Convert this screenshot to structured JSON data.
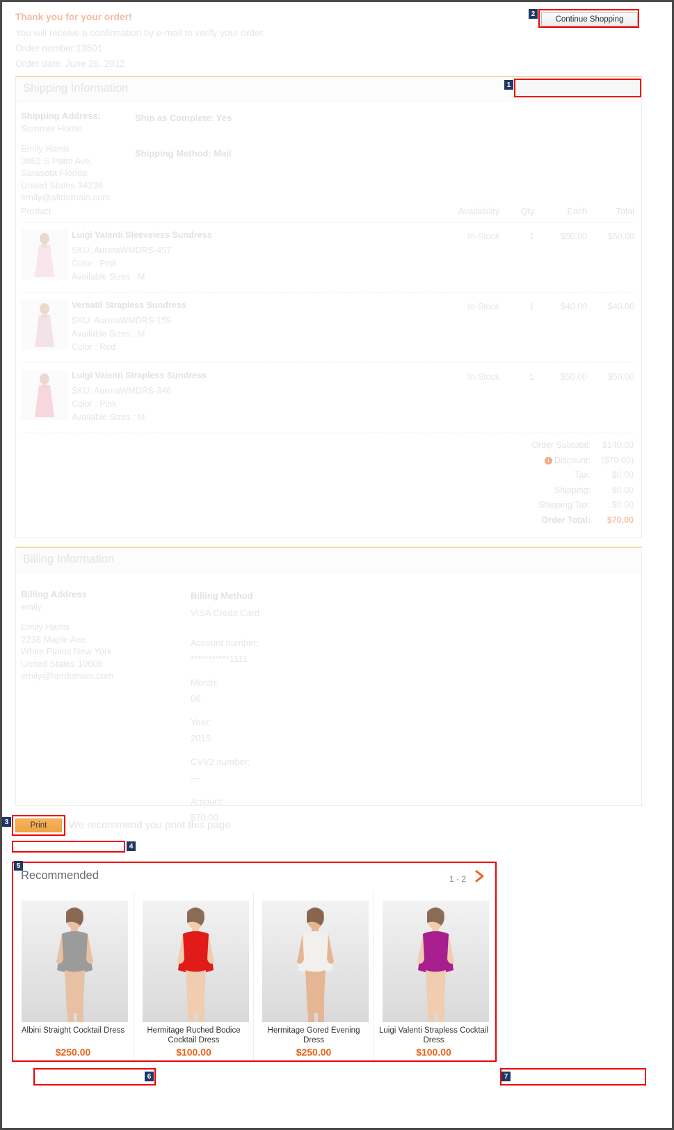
{
  "header": {
    "thank_you": "Thank you for your order!",
    "confirmation": "You will receive a confirmation by e-mail to verify your order.",
    "order_number": "Order number:13501",
    "order_date": "Order date: June 26, 2012",
    "continue_shopping": "Continue Shopping"
  },
  "shipping": {
    "section_title": "Shipping Information",
    "address_label": "Shipping Address:",
    "address_nickname": "Summer Home",
    "name": "Emily Harris",
    "street": "3862 S Palm Ave.",
    "city_state": "Sarasota Florida",
    "country_zip": "United States 34236",
    "email": "emily@altdomain.com",
    "ship_as_complete": "Ship as Complete: Yes",
    "shipping_method": "Shipping Method: Mail"
  },
  "product_table": {
    "columns": {
      "product": "Product",
      "availability": "Availability",
      "qty": "Qty",
      "each": "Each",
      "total": "Total"
    },
    "rows": [
      {
        "name": "Luigi Valenti Sleeveless Sundress",
        "sku": "SKU: AuroraWMDRS-457",
        "attr1": "Color : Pink",
        "attr2": "Available Sizes : M",
        "availability": "In-Stock",
        "qty": "1",
        "each": "$50.00",
        "total": "$50.00",
        "thumb_color": "#f7c9d4"
      },
      {
        "name": "Versatil Strapless Sundress",
        "sku": "SKU: AuroraWMDRS-159",
        "attr1": "Available Sizes : M",
        "attr2": "Color : Red",
        "availability": "In-Stock",
        "qty": "1",
        "each": "$40.00",
        "total": "$40.00",
        "thumb_color": "#e8c3cf"
      },
      {
        "name": "Luigi Valenti Strapless Sundress",
        "sku": "SKU: AuroraWMDRS-346",
        "attr1": "Color : Pink",
        "attr2": "Available Sizes : M",
        "availability": "In-Stock",
        "qty": "1",
        "each": "$50.00",
        "total": "$50.00",
        "thumb_color": "#f3a9b8"
      }
    ]
  },
  "totals": [
    {
      "label": "Order Subtotal:",
      "value": "$140.00",
      "icon": ""
    },
    {
      "label": "Discount:",
      "value": "($70.00)",
      "icon": "info-icon"
    },
    {
      "label": "Tax:",
      "value": "$0.00",
      "icon": ""
    },
    {
      "label": "Shipping:",
      "value": "$0.00",
      "icon": ""
    },
    {
      "label": "Shipping Tax:",
      "value": "$0.00",
      "icon": ""
    },
    {
      "label": "Order Total:",
      "value": "$70.00",
      "icon": ""
    }
  ],
  "billing": {
    "section_title": "Billing Information",
    "address_label": "Billing Address",
    "address_nickname": "emily",
    "name": "Emily Harris",
    "street": "2238 Maple Ave.",
    "city_state": "White Plains New York",
    "country_zip": "United States 10606",
    "email": "emily@herdomain.com",
    "method_label": "Billing Method",
    "method_value": "VISA Credit Card",
    "account_label": "Account number:",
    "account_value": "***********1111",
    "month_label": "Month:",
    "month_value": "06",
    "year_label": "Year:",
    "year_value": "2015",
    "cvv_label": "CVV2 number:",
    "cvv_value": "---",
    "amount_label": "Amount:",
    "amount_value": "$70.00"
  },
  "print_row": {
    "print_label": "Print",
    "hint": "We recommend you print this page"
  },
  "recommended": {
    "title": "Recommended",
    "pager": "1 - 2",
    "next_arrow": "chevron-right-icon",
    "items": [
      {
        "name": "Albini Straight Cocktail Dress",
        "price": "$250.00",
        "dress_color": "#9b9b9b",
        "skin": "#e8c0a4"
      },
      {
        "name": "Hermitage Ruched Bodice Cocktail Dress",
        "price": "$100.00",
        "dress_color": "#e01b18",
        "skin": "#f0cdb0"
      },
      {
        "name": "Hermitage Gored Evening Dress",
        "price": "$250.00",
        "dress_color": "#f2f0ec",
        "skin": "#e4b694"
      },
      {
        "name": "Luigi Valenti Strapless Cocktail Dress",
        "price": "$100.00",
        "dress_color": "#a81e8e",
        "skin": "#f0cdb0"
      }
    ]
  },
  "annotations": [
    {
      "id": "1"
    },
    {
      "id": "2"
    },
    {
      "id": "3"
    },
    {
      "id": "4"
    },
    {
      "id": "5"
    },
    {
      "id": "6"
    },
    {
      "id": "7"
    }
  ],
  "colors": {
    "accent_orange": "#e8631a",
    "annotation_red": "#ee0000",
    "badge_navy": "#1f3864",
    "print_orange": "#efa347",
    "card_top_rule": "#f5d9a8"
  }
}
